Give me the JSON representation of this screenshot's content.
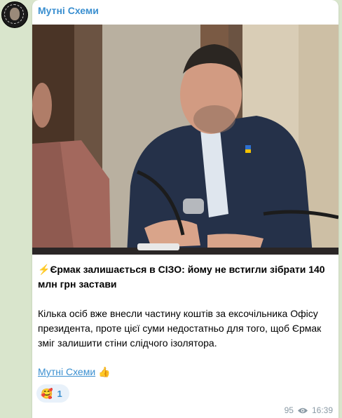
{
  "channel": {
    "name": "Мутні Схеми",
    "avatar_icon": "channel-logo-icon"
  },
  "post": {
    "photo_icon": "post-photo",
    "headline_prefix": "⚡️",
    "headline": "Єрмак залишається в СІЗО: йому не встигли зібрати 140 млн грн застави",
    "body": "Кілька осіб вже внесли частину коштів за ексочільника Офісу президента, проте цієї суми недостатньо для того, щоб Єрмак зміг залишити стіни слідчого ізолятора.",
    "signature_link": "Мутні Схеми",
    "signature_emoji": "👍"
  },
  "reactions": [
    {
      "emoji": "🥰",
      "count": "1"
    }
  ],
  "meta": {
    "views": "95",
    "views_icon": "eye-icon",
    "time": "16:39"
  },
  "colors": {
    "accent": "#3a8fd0",
    "chat_background": "#d9e5cc",
    "bubble": "#ffffff",
    "meta_text": "#8a9aa5"
  }
}
